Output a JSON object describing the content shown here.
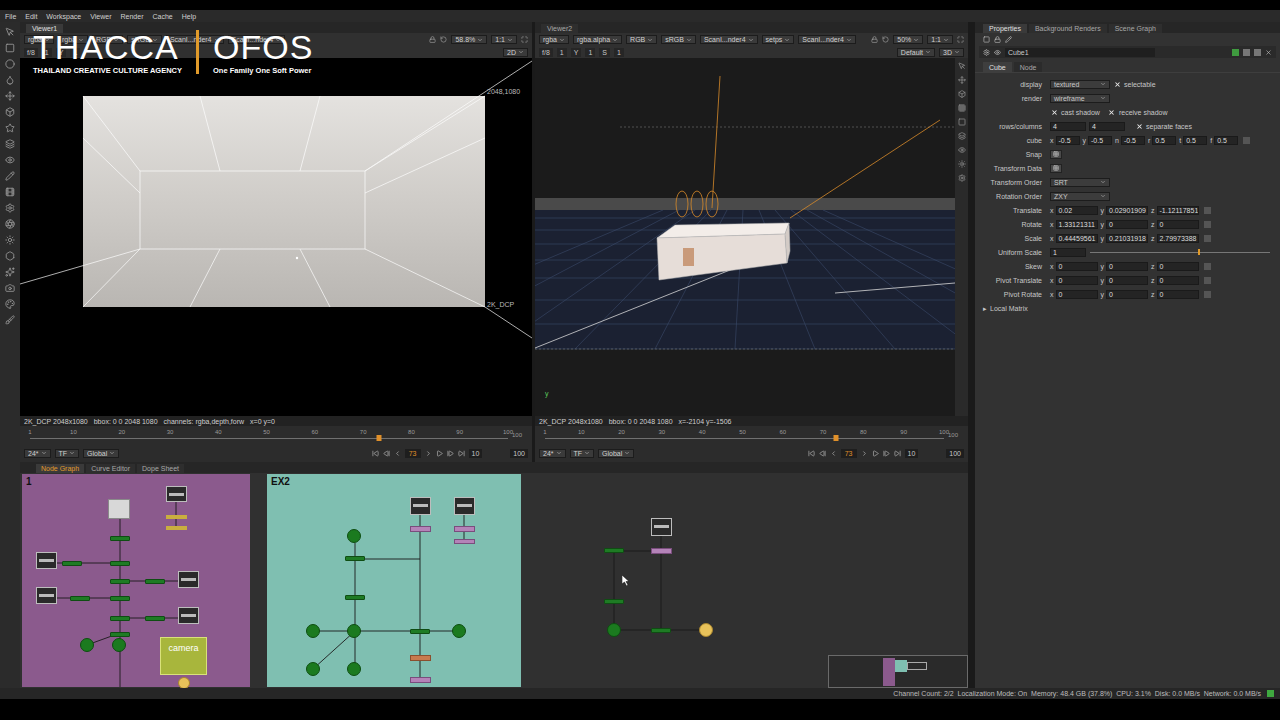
{
  "menu": [
    "File",
    "Edit",
    "Workspace",
    "Viewer",
    "Render",
    "Cache",
    "Help"
  ],
  "logo": {
    "left": "THACCA",
    "right": "OFOS",
    "left_caption": "THAILAND CREATIVE CULTURE AGENCY",
    "right_caption": "One Family One Soft Power"
  },
  "viewers": [
    {
      "tab": "Viewer1",
      "selected": true,
      "channels": [
        "rgba",
        "rgba",
        "RGB",
        "sRGB"
      ],
      "inputs": [
        "ScanI...nder4",
        "ScanI...nder4"
      ],
      "zoom": "58.8%",
      "ratio": "1:1",
      "controls": [
        "f/8",
        "1",
        "Y",
        "1"
      ],
      "mode": "2D",
      "corner_label": "2048,1080",
      "format_label": "2K_DCP",
      "info": [
        "2K_DCP 2048x1080",
        "bbox: 0 0 2048 1080",
        "channels: rgba,depth,forw",
        "x=0 y=0"
      ]
    },
    {
      "tab": "Viewer2",
      "selected": false,
      "channels": [
        "rgba",
        "rgba.alpha",
        "RGB",
        "sRGB"
      ],
      "inputs": [
        "ScanI...nder4",
        "setps",
        "ScanI...nder4"
      ],
      "zoom": "50%",
      "ratio": "1:1",
      "controls": [
        "f/8",
        "1",
        "Y",
        "1",
        "S",
        "1"
      ],
      "lens": "Default",
      "mode": "3D",
      "axis_label": "y",
      "info": [
        "2K_DCP 2048x1080",
        "bbox: 0 0 2048 1080",
        "x=-2104 y=-1506"
      ]
    }
  ],
  "timelines": [
    {
      "ticks": [
        "1",
        "10",
        "20",
        "30",
        "40",
        "50",
        "60",
        "70",
        "80",
        "90",
        "100"
      ],
      "playhead": 0.73,
      "end_label": "100",
      "fps": "24*",
      "tf": "TF",
      "scope": "Global",
      "frame": "73",
      "step": "10",
      "end": "100"
    },
    {
      "ticks": [
        "1",
        "10",
        "20",
        "30",
        "40",
        "50",
        "60",
        "70",
        "80",
        "90",
        "100"
      ],
      "playhead": 0.73,
      "end_label": "100",
      "fps": "24*",
      "tf": "TF",
      "scope": "Global",
      "frame": "73",
      "step": "10",
      "end": "100"
    }
  ],
  "node_graph": {
    "tabs": [
      {
        "label": "Node Graph",
        "selected": true
      },
      {
        "label": "Curve Editor",
        "selected": false
      },
      {
        "label": "Dope Sheet",
        "selected": false
      }
    ],
    "backdrops": [
      {
        "label": "1",
        "color": "#8b5a8d"
      },
      {
        "label": "EX2",
        "color": "#7fbfb1"
      }
    ],
    "camera_label": "camera",
    "node_kinds": [
      "light-card",
      "read",
      "yellow",
      "yellow",
      "transform",
      "read",
      "transform",
      "transform",
      "transform",
      "transform",
      "read",
      "read",
      "transform",
      "transform",
      "transform",
      "transform",
      "read",
      "transform",
      "sphere",
      "sphere",
      "camera",
      "yellow-dot",
      "read",
      "read",
      "purple",
      "purple",
      "purple",
      "sphere",
      "transform",
      "transform",
      "sphere",
      "sphere",
      "transform",
      "sphere",
      "orange",
      "sphere",
      "sphere",
      "purple",
      "read",
      "purple",
      "transform",
      "transform",
      "sphere",
      "transform",
      "yellow-dot"
    ]
  },
  "properties": {
    "tabs": [
      {
        "label": "Properties",
        "selected": true
      },
      {
        "label": "Background Renders",
        "selected": false
      },
      {
        "label": "Scene Graph",
        "selected": false
      }
    ],
    "node_name": "Cube1",
    "node_tabs": [
      {
        "label": "Cube",
        "selected": true
      },
      {
        "label": "Node",
        "selected": false
      }
    ],
    "rows": [
      {
        "kind": "dropdown",
        "label": "display",
        "value": "textured",
        "check": {
          "label": "selectable",
          "checked": true
        }
      },
      {
        "kind": "dropdown",
        "label": "render",
        "value": "wireframe"
      },
      {
        "kind": "checks",
        "checks": [
          {
            "label": "cast shadow",
            "checked": true
          },
          {
            "label": "receive shadow",
            "checked": true
          }
        ]
      },
      {
        "kind": "pair",
        "label": "rows/columns",
        "values": [
          "4",
          "4"
        ],
        "check": {
          "label": "separate faces",
          "checked": true
        }
      },
      {
        "kind": "fields",
        "label": "cube",
        "fields": [
          {
            "axis": "x",
            "value": "-0.5"
          },
          {
            "axis": "y",
            "value": "-0.5"
          },
          {
            "axis": "n",
            "value": "-0.5"
          },
          {
            "axis": "r",
            "value": "0.5"
          },
          {
            "axis": "t",
            "value": "0.5"
          },
          {
            "axis": "f",
            "value": "0.5"
          }
        ]
      },
      {
        "kind": "button",
        "label": "Snap"
      },
      {
        "kind": "button",
        "label": "Transform Data"
      },
      {
        "kind": "dropdown",
        "label": "Transform Order",
        "value": "SRT"
      },
      {
        "kind": "dropdown",
        "label": "Rotation Order",
        "value": "ZXY"
      },
      {
        "kind": "fields",
        "label": "Translate",
        "fields": [
          {
            "axis": "x",
            "value": "0.02"
          },
          {
            "axis": "y",
            "value": "0.02901909"
          },
          {
            "axis": "z",
            "value": "-1.12117851"
          }
        ]
      },
      {
        "kind": "fields",
        "label": "Rotate",
        "fields": [
          {
            "axis": "x",
            "value": "1.33121311"
          },
          {
            "axis": "y",
            "value": "0"
          },
          {
            "axis": "z",
            "value": "0"
          }
        ]
      },
      {
        "kind": "fields",
        "label": "Scale",
        "fields": [
          {
            "axis": "x",
            "value": "0.44459561"
          },
          {
            "axis": "y",
            "value": "0.21031918"
          },
          {
            "axis": "z",
            "value": "2.79973388"
          }
        ]
      },
      {
        "kind": "slider",
        "label": "Uniform Scale",
        "value": "1",
        "level": 0.6
      },
      {
        "kind": "fields",
        "label": "Skew",
        "fields": [
          {
            "axis": "x",
            "value": "0"
          },
          {
            "axis": "y",
            "value": "0"
          },
          {
            "axis": "z",
            "value": "0"
          }
        ]
      },
      {
        "kind": "fields",
        "label": "Pivot Translate",
        "fields": [
          {
            "axis": "x",
            "value": "0"
          },
          {
            "axis": "y",
            "value": "0"
          },
          {
            "axis": "z",
            "value": "0"
          }
        ]
      },
      {
        "kind": "fields",
        "label": "Pivot Rotate",
        "fields": [
          {
            "axis": "x",
            "value": "0"
          },
          {
            "axis": "y",
            "value": "0"
          },
          {
            "axis": "z",
            "value": "0"
          }
        ]
      },
      {
        "kind": "section",
        "label": "Local Matrix",
        "toggle": "▸",
        "expanded": false
      }
    ]
  },
  "status_bar": "Channel Count: 2/2  Localization Mode: On  Memory: 48.4 GB (37.8%)  CPU: 3.1%  Disk: 0.0 MB/s  Network: 0.0 MB/s"
}
